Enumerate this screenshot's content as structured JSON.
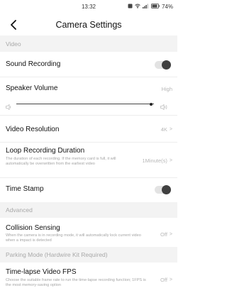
{
  "status": {
    "time": "13:32",
    "battery": "74%"
  },
  "header": {
    "title": "Camera Settings"
  },
  "sections": {
    "video": "Video",
    "advanced": "Advanced",
    "parking": "Parking Mode (Hardwire Kit Required)"
  },
  "rows": {
    "sound_recording": {
      "label": "Sound Recording",
      "enabled": true
    },
    "speaker_volume": {
      "label": "Speaker Volume",
      "value": "High",
      "level": 0.98
    },
    "video_resolution": {
      "label": "Video Resolution",
      "value": "4K"
    },
    "loop_recording": {
      "label": "Loop Recording Duration",
      "desc": "The duration of each recording. If the memory card is full, it will automatically be overwritten from the earliest video",
      "value": "1Minute(s)"
    },
    "time_stamp": {
      "label": "Time Stamp",
      "enabled": true
    },
    "collision_sensing": {
      "label": "Collision Sensing",
      "desc": "When the camera is in recording mode, it will automatically lock current video when a impact is detected",
      "value": "Off"
    },
    "timelapse_fps": {
      "label": "Time-lapse Video FPS",
      "desc": "Choose the suitable frame rate to run the time-lapse recording function; 1FPS is the most memory-saving option",
      "value": "Off"
    }
  }
}
